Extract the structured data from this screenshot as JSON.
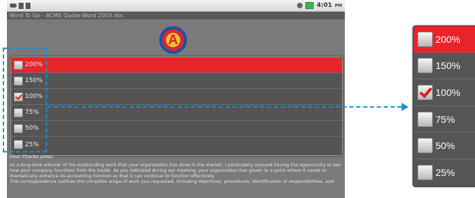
{
  "status_bar": {
    "time": "4:01",
    "ampm": "PM"
  },
  "window_title": "Word To Go - ACME Quote-Word 2003.doc",
  "logo_letter": "A",
  "zoom_menu": {
    "items": [
      {
        "label": "200%",
        "checked": false,
        "selected": true
      },
      {
        "label": "150%",
        "checked": false,
        "selected": false
      },
      {
        "label": "100%",
        "checked": true,
        "selected": false
      },
      {
        "label": "75%",
        "checked": false,
        "selected": false
      },
      {
        "label": "50%",
        "checked": false,
        "selected": false
      },
      {
        "label": "25%",
        "checked": false,
        "selected": false
      }
    ]
  },
  "document": {
    "greeting": "Dear Charles Jones:",
    "paragraph1": "As a long-time admirer of the outstanding work that your organization has done in the market, I particularly enjoyed having the opportunity to see how your company functions from the inside. As you indicated during our meeting, your organization has grown to a point where it needs to dramatically enhance its accounting function so that it can continue to function effectively.",
    "paragraph2": "This correspondence outlines the complete scope of work you requested, including objectives, procedures, identification of responsibilities, and"
  },
  "colors": {
    "selected": "#e8232a",
    "check": "#d51f26",
    "callout": "#1d8fd0"
  }
}
